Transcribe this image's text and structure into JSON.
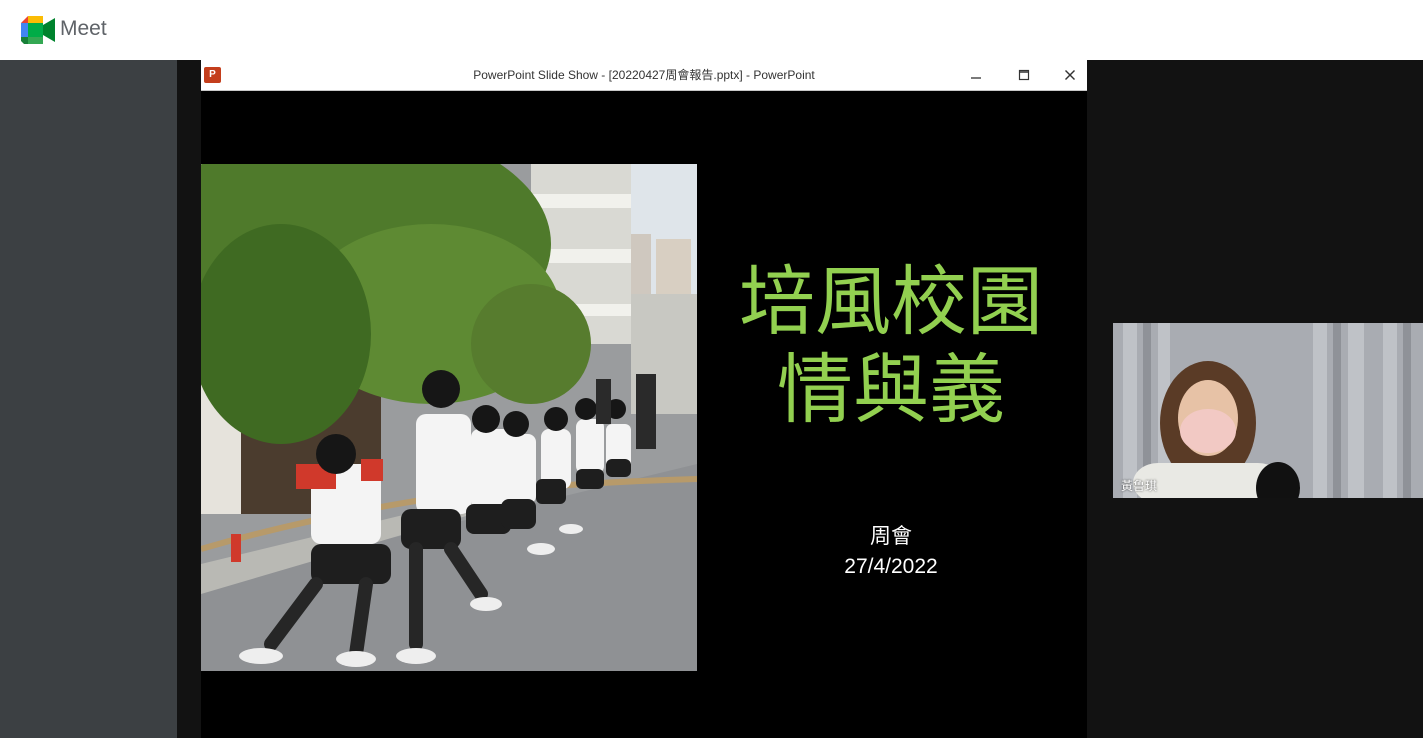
{
  "app": {
    "name": "Meet",
    "icon": "google-meet-logo"
  },
  "presentation_window": {
    "title": "PowerPoint Slide Show - [20220427周會報告.pptx] - PowerPoint",
    "app_icon": "powerpoint-icon",
    "app_icon_letter": "P",
    "controls": {
      "minimize_icon": "minimize-icon",
      "maximize_icon": "maximize-icon",
      "close_icon": "close-icon"
    }
  },
  "slide": {
    "title_lines": [
      "培風校園",
      "情與義"
    ],
    "subtitle": "周會",
    "date": "27/4/2022",
    "title_color": "#92d050",
    "background": "#000000"
  },
  "participant": {
    "name": "黃鲁琪"
  },
  "colors": {
    "sidebar": "#3c4043",
    "stage": "#121212",
    "ppt_icon": "#c43e1c"
  }
}
